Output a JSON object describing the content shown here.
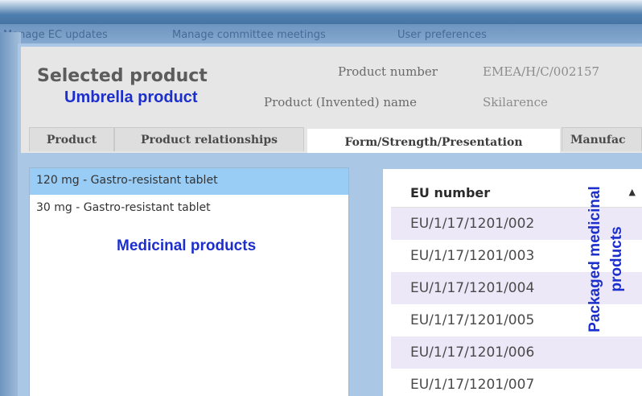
{
  "background": {
    "menu_items": [
      "Manage EC updates",
      "Manage committee meetings",
      "User preferences"
    ]
  },
  "header": {
    "title": "Selected product",
    "product_number_label": "Product number",
    "product_number_value": "EMEA/H/C/002157",
    "invented_name_label": "Product (Invented) name",
    "invented_name_value": "Skilarence"
  },
  "tabs": [
    {
      "label": "Product",
      "active": false
    },
    {
      "label": "Product relationships",
      "active": false
    },
    {
      "label": "Form/Strength/Presentation",
      "active": true
    },
    {
      "label": "Manufac",
      "active": false
    }
  ],
  "medicinal_products": [
    {
      "label": "120 mg - Gastro-resistant tablet",
      "selected": true
    },
    {
      "label": "30 mg - Gastro-resistant tablet",
      "selected": false
    }
  ],
  "packages_grid": {
    "column_header": "EU number",
    "sort_icon": "sort-ascending-icon",
    "rows": [
      "EU/1/17/1201/002",
      "EU/1/17/1201/003",
      "EU/1/17/1201/004",
      "EU/1/17/1201/005",
      "EU/1/17/1201/006",
      "EU/1/17/1201/007"
    ]
  },
  "annotations": {
    "umbrella": "Umbrella product",
    "medicinal": "Medicinal products",
    "packaged_line1": "Packaged medicinal",
    "packaged_line2": "products"
  },
  "colors": {
    "annotation": "#1c2fcc",
    "selected_row": "#9acdf6",
    "frame": "#aac7e6",
    "grid_alt_row": "#ece8f8"
  }
}
